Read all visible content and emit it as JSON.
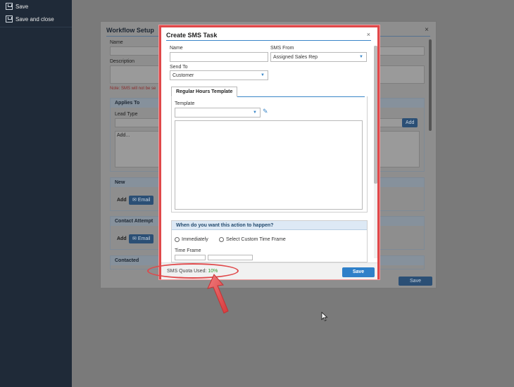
{
  "sidebar": {
    "items": [
      {
        "label": "Save",
        "icon": "save-icon"
      },
      {
        "label": "Save and close",
        "icon": "save-close-icon"
      }
    ]
  },
  "workflow": {
    "title": "Workflow Setup",
    "close": "×",
    "name_label": "Name",
    "description_label": "Description",
    "note": "Note: SMS will not be se",
    "applies_to": "Applies To",
    "lead_type_label": "Lead Type",
    "add_placeholder": "Add...",
    "add_button": "Add",
    "new_section": "New",
    "contact_attempt_section": "Contact Attempt",
    "contacted_section": "Contacted",
    "add_label": "Add",
    "email_button": "Email",
    "save_button": "Save"
  },
  "modal": {
    "title": "Create SMS Task",
    "close": "×",
    "name_label": "Name",
    "name_value": "",
    "sms_from_label": "SMS From",
    "sms_from_value": "Assigned Sales Rep",
    "send_to_label": "Send To",
    "send_to_value": "Customer",
    "tab_label": "Regular Hours Template",
    "template_label": "Template",
    "template_value": "",
    "when_header": "When do you want this action to happen?",
    "radio_immediately": "Immediately",
    "radio_custom": "Select Custom Time Frame",
    "time_frame_label": "Time Frame",
    "quota_label": "SMS Quota Used:",
    "quota_value": "10%",
    "save_button": "Save"
  },
  "colors": {
    "accent": "#2f80c9",
    "annotation": "#e0484a",
    "quota_green": "#2d9a2d",
    "sidebar_bg": "#1f2a38"
  }
}
